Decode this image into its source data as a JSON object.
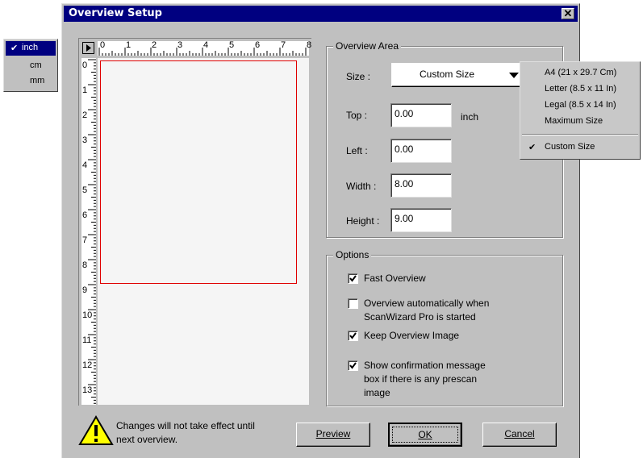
{
  "window": {
    "title": "Overview Setup",
    "close_label": "✕"
  },
  "unit_menu": {
    "items": [
      "inch",
      "cm",
      "mm"
    ],
    "selected": 0
  },
  "ruler": {
    "h_labels": [
      "0",
      "1",
      "2",
      "3",
      "4",
      "5",
      "6",
      "7",
      "8"
    ],
    "v_labels": [
      "0",
      "1",
      "2",
      "3",
      "4",
      "5",
      "6",
      "7",
      "8",
      "9",
      "10",
      "11",
      "12",
      "13"
    ]
  },
  "overview_area": {
    "label": "Overview Area",
    "size_label": "Size :",
    "size_value": "Custom Size",
    "top_label": "Top :",
    "top_value": "0.00",
    "unit": "inch",
    "left_label": "Left :",
    "left_value": "0.00",
    "width_label": "Width :",
    "width_value": "8.00",
    "height_label": "Height :",
    "height_value": "9.00"
  },
  "size_menu": {
    "items": [
      "A4 (21 x 29.7 Cm)",
      "Letter (8.5 x 11 In)",
      "Legal (8.5 x 14 In)",
      "Maximum Size"
    ],
    "checked_item": "Custom Size"
  },
  "options": {
    "label": "Options",
    "fast_overview": {
      "label": "Fast Overview",
      "checked": true
    },
    "auto_overview": {
      "line1": "Overview automatically when",
      "line2": "ScanWizard Pro is started",
      "checked": false
    },
    "keep_image": {
      "label": "Keep Overview Image",
      "checked": true
    },
    "show_confirm": {
      "line1": "Show confirmation message",
      "line2": "box if there is any prescan",
      "line3": "image",
      "checked": true
    }
  },
  "warning": {
    "line1": "Changes will not take effect until",
    "line2": "next overview."
  },
  "buttons": {
    "preview": "Preview",
    "ok": "OK",
    "cancel": "Cancel"
  }
}
